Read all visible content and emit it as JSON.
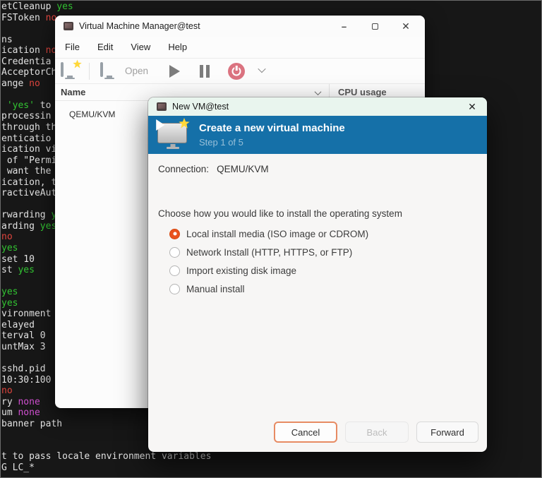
{
  "colors": {
    "fg": "#e2e2e2",
    "g": "#32c532",
    "r": "#e0453e",
    "m": "#d04fd0",
    "terminal_bg": "#171717",
    "accent_orange": "#E9531F",
    "banner_blue": "#1570a8",
    "titlebar_mint": "#e9f5ee"
  },
  "terminal": {
    "lines": [
      {
        "segments": [
          {
            "t": "etCleanup ",
            "c": "fg"
          },
          {
            "t": "yes",
            "c": "g"
          }
        ]
      },
      {
        "segments": [
          {
            "t": "FSToken ",
            "c": "fg"
          },
          {
            "t": "no",
            "c": "r"
          }
        ]
      },
      {
        "segments": []
      },
      {
        "segments": [
          {
            "t": "ns",
            "c": "fg"
          }
        ]
      },
      {
        "segments": [
          {
            "t": "ication ",
            "c": "fg"
          },
          {
            "t": "no",
            "c": "r"
          }
        ]
      },
      {
        "segments": [
          {
            "t": "Credentia",
            "c": "fg"
          }
        ]
      },
      {
        "segments": [
          {
            "t": "AcceptorCh",
            "c": "fg"
          }
        ]
      },
      {
        "segments": [
          {
            "t": "ange ",
            "c": "fg"
          },
          {
            "t": "no",
            "c": "r"
          }
        ]
      },
      {
        "segments": []
      },
      {
        "segments": [
          {
            "t": " ",
            "c": "fg"
          },
          {
            "t": "'yes'",
            "c": "g"
          },
          {
            "t": " to",
            "c": "fg"
          }
        ]
      },
      {
        "segments": [
          {
            "t": "processin",
            "c": "fg"
          }
        ]
      },
      {
        "segments": [
          {
            "t": "through th",
            "c": "fg"
          }
        ]
      },
      {
        "segments": [
          {
            "t": "enticatio",
            "c": "fg"
          }
        ]
      },
      {
        "segments": [
          {
            "t": "ication vi",
            "c": "fg"
          }
        ]
      },
      {
        "segments": [
          {
            "t": " of \"Permi",
            "c": "fg"
          }
        ]
      },
      {
        "segments": [
          {
            "t": " want the",
            "c": "fg"
          }
        ]
      },
      {
        "segments": [
          {
            "t": "ication, t",
            "c": "fg"
          }
        ]
      },
      {
        "segments": [
          {
            "t": "ractiveAut",
            "c": "fg"
          }
        ]
      },
      {
        "segments": []
      },
      {
        "segments": [
          {
            "t": "rwarding ",
            "c": "fg"
          },
          {
            "t": "y",
            "c": "g"
          }
        ]
      },
      {
        "segments": [
          {
            "t": "arding ",
            "c": "fg"
          },
          {
            "t": "yes",
            "c": "g"
          }
        ]
      },
      {
        "segments": [
          {
            "t": "no",
            "c": "r"
          }
        ]
      },
      {
        "segments": [
          {
            "t": "yes",
            "c": "g"
          }
        ]
      },
      {
        "segments": [
          {
            "t": "set 10",
            "c": "fg"
          }
        ]
      },
      {
        "segments": [
          {
            "t": "st ",
            "c": "fg"
          },
          {
            "t": "yes",
            "c": "g"
          }
        ]
      },
      {
        "segments": []
      },
      {
        "segments": [
          {
            "t": "yes",
            "c": "g"
          }
        ]
      },
      {
        "segments": [
          {
            "t": "yes",
            "c": "g"
          }
        ]
      },
      {
        "segments": [
          {
            "t": "vironment",
            "c": "fg"
          }
        ]
      },
      {
        "segments": [
          {
            "t": "elayed",
            "c": "fg"
          }
        ]
      },
      {
        "segments": [
          {
            "t": "terval 0",
            "c": "fg"
          }
        ]
      },
      {
        "segments": [
          {
            "t": "untMax 3",
            "c": "fg"
          }
        ]
      },
      {
        "segments": []
      },
      {
        "segments": [
          {
            "t": "sshd.pid",
            "c": "fg"
          }
        ]
      },
      {
        "segments": [
          {
            "t": "10:30:100",
            "c": "fg"
          }
        ]
      },
      {
        "segments": [
          {
            "t": "no",
            "c": "r"
          }
        ]
      },
      {
        "segments": [
          {
            "t": "ry ",
            "c": "fg"
          },
          {
            "t": "none",
            "c": "m"
          }
        ]
      },
      {
        "segments": [
          {
            "t": "um ",
            "c": "fg"
          },
          {
            "t": "none",
            "c": "m"
          }
        ]
      },
      {
        "segments": [
          {
            "t": "banner path",
            "c": "fg"
          }
        ]
      },
      {
        "segments": []
      },
      {
        "segments": []
      },
      {
        "segments": [
          {
            "t": "t to pass locale environment variables",
            "c": "fg"
          }
        ]
      },
      {
        "segments": [
          {
            "t": "G LC_*",
            "c": "fg"
          }
        ]
      }
    ]
  },
  "vmm_window": {
    "title": "Virtual Machine Manager@test",
    "menu": [
      "File",
      "Edit",
      "View",
      "Help"
    ],
    "toolbar": {
      "open_label": "Open"
    },
    "columns": {
      "name": "Name",
      "cpu": "CPU usage"
    },
    "rows": [
      {
        "name": "QEMU/KVM"
      }
    ],
    "window_controls": {
      "minimize": "–",
      "close": "✕"
    }
  },
  "dialog": {
    "title": "New VM@test",
    "close": "✕",
    "banner": {
      "title": "Create a new virtual machine",
      "step": "Step 1 of 5"
    },
    "connection": {
      "label": "Connection:",
      "value": "QEMU/KVM"
    },
    "choose_label": "Choose how you would like to install the operating system",
    "options": [
      {
        "label": "Local install media (ISO image or CDROM)",
        "selected": true
      },
      {
        "label": "Network Install (HTTP, HTTPS, or FTP)",
        "selected": false
      },
      {
        "label": "Import existing disk image",
        "selected": false
      },
      {
        "label": "Manual install",
        "selected": false
      }
    ],
    "buttons": {
      "cancel": "Cancel",
      "back": "Back",
      "forward": "Forward"
    }
  }
}
